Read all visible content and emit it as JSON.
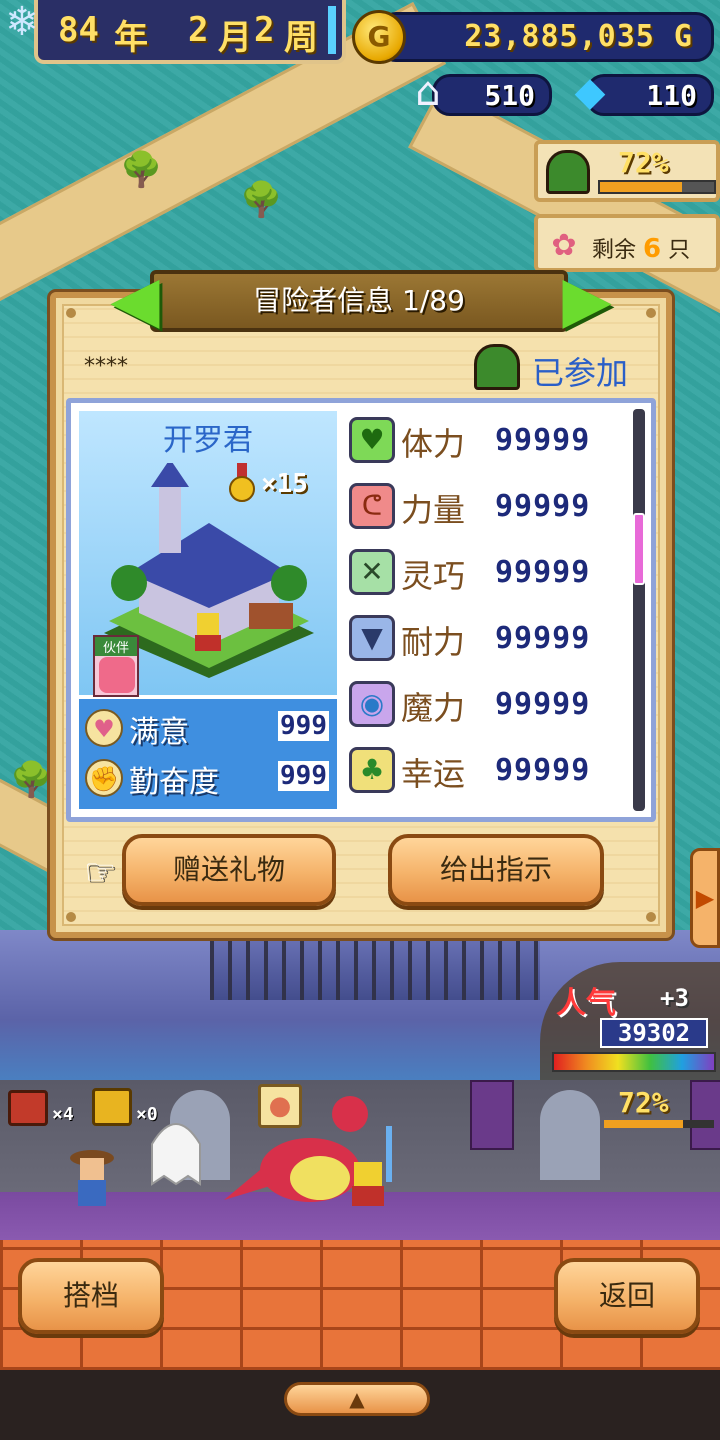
{
  "hud": {
    "year": "84",
    "year_unit": "年",
    "month": "2",
    "month_unit": "月",
    "week": "2",
    "week_unit": "周",
    "gold": "23,885,035 G",
    "gold_coin_letter": "G",
    "houses": "510",
    "gems": "110"
  },
  "side": {
    "cave_percent": "72%",
    "cave_progress": 0.72,
    "remain_label": "剩余",
    "remain_count": "6",
    "remain_unit": "只"
  },
  "dialog": {
    "title": "冒险者信息 1/89",
    "rank_stars": "****",
    "status": "已参加",
    "character": {
      "name": "开罗君",
      "medal_count": "×15",
      "partner_label": "伙伴"
    },
    "mood": [
      {
        "label": "满意",
        "value": "999",
        "icon": "heart-icon"
      },
      {
        "label": "勤奋度",
        "value": "999",
        "icon": "fist-icon"
      }
    ],
    "stats": [
      {
        "label": "体力",
        "value": "99999",
        "icon": "heart-icon",
        "color": "#7ed957",
        "glyph": "♥"
      },
      {
        "label": "力量",
        "value": "99999",
        "icon": "muscle-icon",
        "color": "#f08a8a",
        "glyph": "💪"
      },
      {
        "label": "灵巧",
        "value": "99999",
        "icon": "crossed-swords-icon",
        "color": "#a6e0a6",
        "glyph": "⚔"
      },
      {
        "label": "耐力",
        "value": "99999",
        "icon": "shield-icon",
        "color": "#9ab6e8",
        "glyph": "⛉"
      },
      {
        "label": "魔力",
        "value": "99999",
        "icon": "magic-orb-icon",
        "color": "#c9a6ec",
        "glyph": "◉"
      },
      {
        "label": "幸运",
        "value": "99999",
        "icon": "clover-icon",
        "color": "#f0e07a",
        "glyph": "♣"
      }
    ],
    "gift_button": "赠送礼物",
    "order_button": "给出指示"
  },
  "popularity": {
    "label": "人气",
    "bonus": "+3",
    "value": "39302"
  },
  "hall": {
    "red_chest_count": "×4",
    "gold_chest_count": "×0",
    "percent": "72%",
    "progress": 0.72
  },
  "bottom": {
    "partner_button": "搭档",
    "back_button": "返回",
    "expand_glyph": "▲"
  }
}
